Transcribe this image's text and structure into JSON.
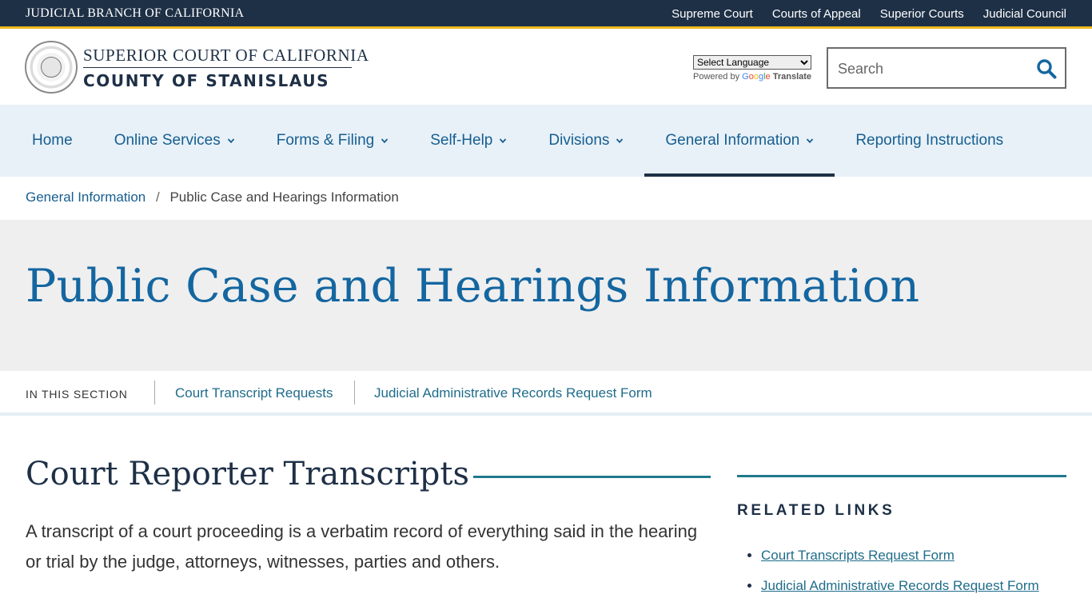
{
  "topbar": {
    "branch": "JUDICIAL BRANCH OF CALIFORNIA",
    "links": [
      "Supreme Court",
      "Courts of Appeal",
      "Superior Courts",
      "Judicial Council"
    ]
  },
  "header": {
    "court_line1": "SUPERIOR COURT OF CALIFORNIA",
    "court_line2": "COUNTY OF STANISLAUS",
    "language_select": "Select Language",
    "powered_by": "Powered by",
    "translate": "Translate",
    "search_placeholder": "Search"
  },
  "nav": {
    "items": [
      {
        "label": "Home"
      },
      {
        "label": "Online Services"
      },
      {
        "label": "Forms & Filing"
      },
      {
        "label": "Self-Help"
      },
      {
        "label": "Divisions"
      },
      {
        "label": "General Information"
      },
      {
        "label": "Reporting Instructions"
      }
    ]
  },
  "breadcrumb": {
    "parent": "General Information",
    "separator": "/",
    "current": "Public Case and Hearings Information"
  },
  "hero": {
    "title": "Public Case and Hearings Information"
  },
  "section_nav": {
    "label": "IN THIS SECTION",
    "links": [
      "Court Transcript Requests",
      "Judicial Administrative Records Request Form"
    ]
  },
  "content": {
    "heading": "Court Reporter Transcripts",
    "paragraph": "A transcript of a court proceeding is a verbatim record of everything said in the hearing or trial by the judge, attorneys, witnesses, parties and others."
  },
  "sidebar": {
    "heading": "RELATED LINKS",
    "links": [
      "Court Transcripts Request Form",
      "Judicial Administrative Records Request Form"
    ]
  },
  "colors": {
    "topbar": "#1e3046",
    "accent_gold": "#f3b91e",
    "link_blue": "#165e90",
    "nav_bg": "#e8f1f8",
    "teal_rule": "#1f7a8c"
  }
}
